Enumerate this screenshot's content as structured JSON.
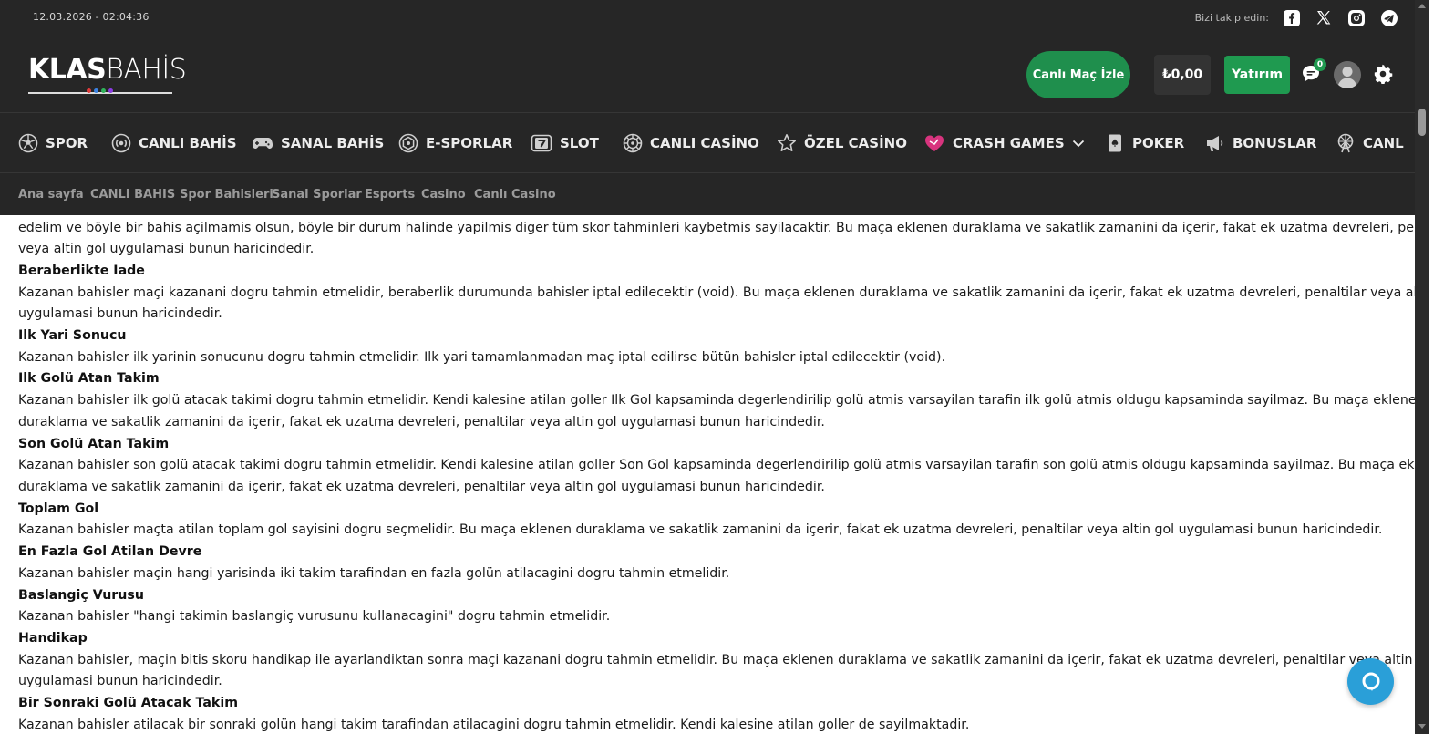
{
  "topbar": {
    "datetime": "12.03.2026 - 02:04:36",
    "follow_label": "Bizi takip edin:",
    "social": [
      "facebook-icon",
      "x-icon",
      "instagram-icon",
      "telegram-icon"
    ]
  },
  "header": {
    "logo_bold": "KLAS",
    "logo_light": "BAHİS",
    "live_match_label": "Canlı Maç İzle",
    "balance": "₺0,00",
    "deposit_label": "Yatırım",
    "messages_count": "0",
    "accent_color": "#1f9a50"
  },
  "nav": {
    "items": [
      {
        "label": "SPOR",
        "icon": "soccer-ball-icon"
      },
      {
        "label": "CANLI BAHİS",
        "icon": "live-signal-icon"
      },
      {
        "label": "SANAL BAHİS",
        "icon": "gamepad-icon"
      },
      {
        "label": "E-SPORLAR",
        "icon": "esports-icon"
      },
      {
        "label": "SLOT",
        "icon": "slot-seven-icon"
      },
      {
        "label": "CANLI CASİNO",
        "icon": "roulette-icon"
      },
      {
        "label": "ÖZEL CASİNO",
        "icon": "star-icon"
      },
      {
        "label": "CRASH GAMES",
        "icon": "rocket-heart-icon"
      },
      {
        "label": "POKER",
        "icon": "card-icon"
      },
      {
        "label": "BONUSLAR",
        "icon": "megaphone-icon"
      },
      {
        "label": "CANL",
        "icon": "ferris-wheel-icon"
      }
    ]
  },
  "breadcrumb": [
    "Ana sayfa",
    "CANLI BAHIS",
    "Spor Bahisleri",
    "Sanal Sporlar",
    "Esports",
    "Casino",
    "Canlı Casino"
  ],
  "content": {
    "lines": [
      {
        "type": "p",
        "text": "edelim ve böyle bir bahis açilmamis olsun, böyle bir durum halinde yapilmis diger tüm skor tahminleri kaybetmis sayilacaktir. Bu maça eklenen duraklama ve sakatlik zamanini da içerir, fakat ek uzatma devreleri, penaltilar"
      },
      {
        "type": "p",
        "text": "veya altin gol uygulamasi bunun haricindedir."
      },
      {
        "type": "h",
        "text": "Beraberlikte Iade"
      },
      {
        "type": "p",
        "text": "Kazanan bahisler maçi kazanani dogru tahmin etmelidir, beraberlik durumunda bahisler iptal edilecektir (void). Bu maça eklenen duraklama ve sakatlik zamanini da içerir, fakat ek uzatma devreleri, penaltilar veya altin gol"
      },
      {
        "type": "p",
        "text": "uygulamasi bunun haricindedir."
      },
      {
        "type": "h",
        "text": "Ilk Yari Sonucu"
      },
      {
        "type": "p",
        "text": "Kazanan bahisler ilk yarinin sonucunu dogru tahmin etmelidir. Ilk yari tamamlanmadan maç iptal edilirse bütün bahisler iptal edilecektir (void)."
      },
      {
        "type": "h",
        "text": "Ilk Golü Atan Takim"
      },
      {
        "type": "p",
        "text": "Kazanan bahisler ilk golü atacak takimi dogru tahmin etmelidir. Kendi kalesine atilan goller Ilk Gol kapsaminda degerlendirilip golü atmis varsayilan tarafin ilk golü atmis oldugu kapsaminda sayilmaz. Bu maça eklenen"
      },
      {
        "type": "p",
        "text": "duraklama ve sakatlik zamanini da içerir, fakat ek uzatma devreleri, penaltilar veya altin gol uygulamasi bunun haricindedir."
      },
      {
        "type": "h",
        "text": "Son Golü Atan Takim"
      },
      {
        "type": "p",
        "text": "Kazanan bahisler son golü atacak takimi dogru tahmin etmelidir. Kendi kalesine atilan goller Son Gol kapsaminda degerlendirilip golü atmis varsayilan tarafin son golü atmis oldugu kapsaminda sayilmaz. Bu maça eklenen"
      },
      {
        "type": "p",
        "text": "duraklama ve sakatlik zamanini da içerir, fakat ek uzatma devreleri, penaltilar veya altin gol uygulamasi bunun haricindedir."
      },
      {
        "type": "h",
        "text": "Toplam Gol"
      },
      {
        "type": "p",
        "text": "Kazanan bahisler maçta atilan toplam gol sayisini dogru seçmelidir. Bu maça eklenen duraklama ve sakatlik zamanini da içerir, fakat ek uzatma devreleri, penaltilar veya altin gol uygulamasi bunun haricindedir."
      },
      {
        "type": "h",
        "text": "En Fazla Gol Atilan Devre"
      },
      {
        "type": "p",
        "text": "Kazanan bahisler maçin hangi yarisinda iki takim tarafindan en fazla golün atilacagini dogru tahmin etmelidir."
      },
      {
        "type": "h",
        "text": "Baslangiç Vurusu"
      },
      {
        "type": "p",
        "text": "Kazanan bahisler \"hangi takimin baslangiç vurusunu kullanacagini\" dogru tahmin etmelidir."
      },
      {
        "type": "h",
        "text": "Handikap"
      },
      {
        "type": "p",
        "text": "Kazanan bahisler, maçin bitis skoru handikap ile ayarlandiktan sonra maçi kazanani dogru tahmin etmelidir. Bu maça eklenen duraklama ve sakatlik zamanini da içerir, fakat ek uzatma devreleri, penaltilar veya altin gol"
      },
      {
        "type": "p",
        "text": "uygulamasi bunun haricindedir."
      },
      {
        "type": "h",
        "text": "Bir Sonraki Golü Atacak Takim"
      },
      {
        "type": "p",
        "text": "Kazanan bahisler atilacak bir sonraki golün hangi takim tarafindan atilacagini dogru tahmin etmelidir. Kendi kalesine atilan goller de sayilmaktadir."
      }
    ]
  },
  "chat_fab": {
    "icon": "chat-bubble-icon"
  }
}
